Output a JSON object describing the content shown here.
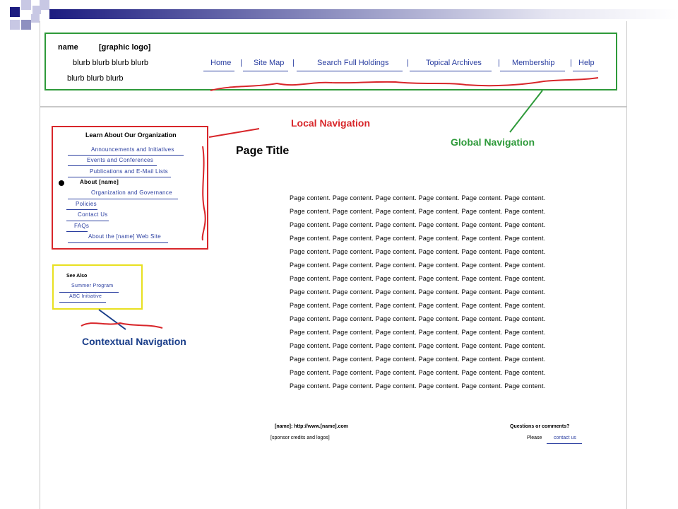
{
  "header": {
    "name": "name",
    "logo": "[graphic logo]",
    "blurb1": "blurb blurb blurb blurb",
    "blurb2": "blurb blurb blurb",
    "global_nav": [
      {
        "label": "Home"
      },
      {
        "label": "Site Map"
      },
      {
        "label": "Search Full Holdings"
      },
      {
        "label": "Topical Archives"
      },
      {
        "label": "Membership"
      },
      {
        "label": "Help"
      }
    ],
    "separator": "|"
  },
  "local_nav": {
    "heading": "Learn About Our Organization",
    "items": [
      {
        "label": "Announcements and Initiatives"
      },
      {
        "label": "Events and Conferences"
      },
      {
        "label": "Publications and E-Mail Lists"
      },
      {
        "label": "About [name]"
      },
      {
        "label": "Organization and Governance"
      },
      {
        "label": "Policies"
      },
      {
        "label": "Contact Us"
      },
      {
        "label": "FAQs"
      },
      {
        "label": "About the [name] Web Site"
      }
    ]
  },
  "contextual_nav": {
    "heading": "See Also",
    "items": [
      {
        "label": "Summer Program"
      },
      {
        "label": "ABC Initiative"
      }
    ]
  },
  "page_title": "Page Title",
  "content_line": "Page content.  Page content.  Page content.  Page content.  Page content.  Page content.",
  "content_line_count": 15,
  "footer": {
    "url": "[name]:  http://www.[name].com",
    "sponsor": "[sponsor  credits  and  logos]",
    "questions": "Questions or comments?",
    "please": "Please",
    "contact": "contact us"
  },
  "annotations": {
    "local": "Local Navigation",
    "global": "Global Navigation",
    "contextual": "Contextual Navigation"
  },
  "colors": {
    "local": "#d8262a",
    "global": "#2e9a3a",
    "contextual_box": "#e8e020",
    "contextual_label": "#1a3e8a",
    "link": "#2a3ea0"
  }
}
